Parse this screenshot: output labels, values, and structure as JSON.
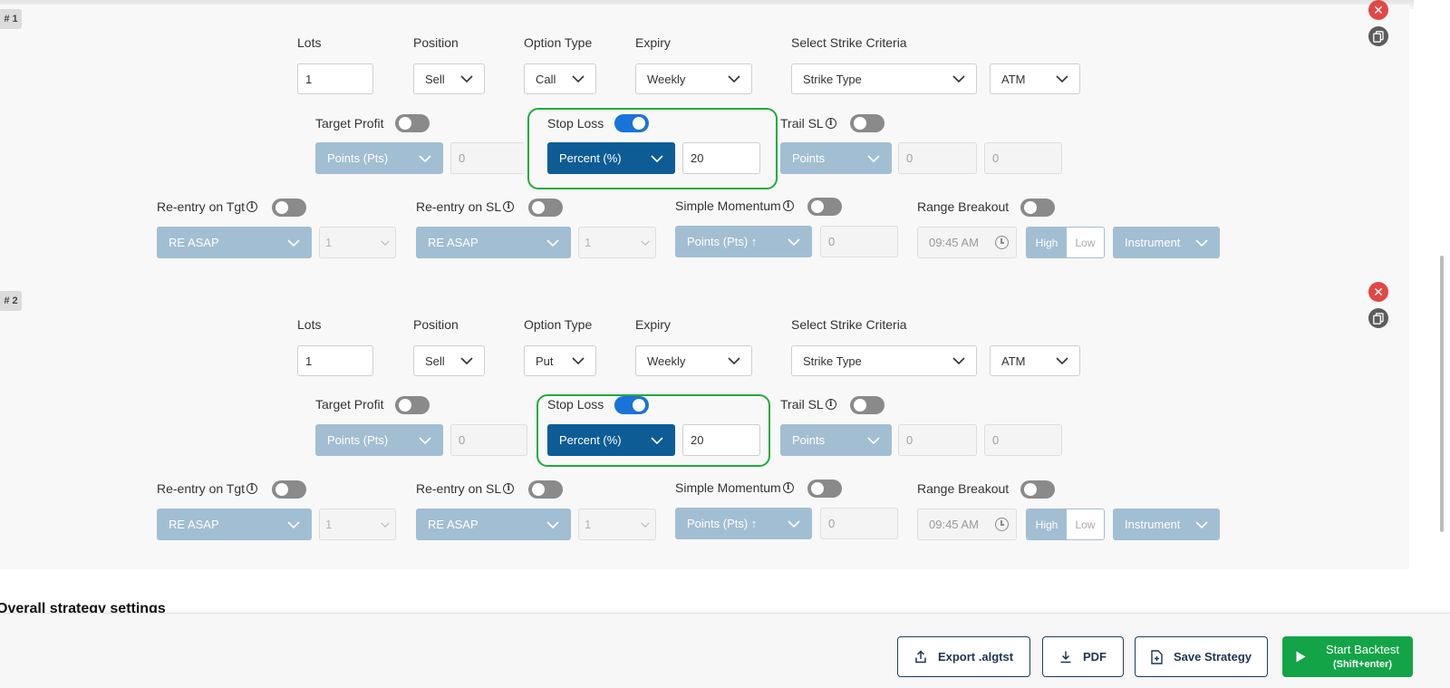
{
  "legs": [
    {
      "tag": "# 1",
      "labels": {
        "lots": "Lots",
        "position": "Position",
        "option_type": "Option Type",
        "expiry": "Expiry",
        "strike_criteria": "Select Strike Criteria"
      },
      "lots_value": "1",
      "position_value": "Sell",
      "option_type_value": "Call",
      "expiry_value": "Weekly",
      "strike_type_value": "Strike Type",
      "strike_value": "ATM",
      "target_profit": {
        "label": "Target Profit",
        "enabled": false,
        "unit": "Points (Pts)",
        "value": "0"
      },
      "stop_loss": {
        "label": "Stop Loss",
        "enabled": true,
        "unit": "Percent (%)",
        "value": "20"
      },
      "trail_sl": {
        "label": "Trail SL",
        "enabled": false,
        "unit": "Points",
        "value1": "0",
        "value2": "0"
      },
      "reentry_tgt": {
        "label": "Re-entry on Tgt",
        "enabled": false,
        "mode": "RE ASAP",
        "count": "1"
      },
      "reentry_sl": {
        "label": "Re-entry on SL",
        "enabled": false,
        "mode": "RE ASAP",
        "count": "1"
      },
      "simple_momentum": {
        "label": "Simple Momentum",
        "enabled": false,
        "unit": "Points (Pts) ↑",
        "value": "0"
      },
      "range_breakout": {
        "label": "Range Breakout",
        "enabled": false,
        "time": "09:45 AM",
        "high": "High",
        "low": "Low",
        "source": "Instrument"
      }
    },
    {
      "tag": "# 2",
      "labels": {
        "lots": "Lots",
        "position": "Position",
        "option_type": "Option Type",
        "expiry": "Expiry",
        "strike_criteria": "Select Strike Criteria"
      },
      "lots_value": "1",
      "position_value": "Sell",
      "option_type_value": "Put",
      "expiry_value": "Weekly",
      "strike_type_value": "Strike Type",
      "strike_value": "ATM",
      "target_profit": {
        "label": "Target Profit",
        "enabled": false,
        "unit": "Points (Pts)",
        "value": "0"
      },
      "stop_loss": {
        "label": "Stop Loss",
        "enabled": true,
        "unit": "Percent (%)",
        "value": "20"
      },
      "trail_sl": {
        "label": "Trail SL",
        "enabled": false,
        "unit": "Points",
        "value1": "0",
        "value2": "0"
      },
      "reentry_tgt": {
        "label": "Re-entry on Tgt",
        "enabled": false,
        "mode": "RE ASAP",
        "count": "1"
      },
      "reentry_sl": {
        "label": "Re-entry on SL",
        "enabled": false,
        "mode": "RE ASAP",
        "count": "1"
      },
      "simple_momentum": {
        "label": "Simple Momentum",
        "enabled": false,
        "unit": "Points (Pts) ↑",
        "value": "0"
      },
      "range_breakout": {
        "label": "Range Breakout",
        "enabled": false,
        "time": "09:45 AM",
        "high": "High",
        "low": "Low",
        "source": "Instrument"
      }
    }
  ],
  "info_glyph": "i",
  "overall_title": "Overall strategy settings",
  "footer": {
    "export_label": "Export .algtst",
    "pdf_label": "PDF",
    "save_label": "Save Strategy",
    "backtest_label": "Start Backtest",
    "backtest_shortcut": "(Shift+enter)"
  },
  "colors": {
    "highlight": "#1fad3b",
    "toggle_on": "#1a73d9",
    "select_blue": "#a2bed2",
    "select_dark": "#0d5c96",
    "delete": "#e04848",
    "backtest": "#13a447"
  },
  "icons": [
    "close-icon",
    "copy-icon",
    "chevron-down-icon",
    "clock-icon",
    "info-icon",
    "upload-icon",
    "download-icon",
    "file-plus-icon",
    "play-icon"
  ]
}
